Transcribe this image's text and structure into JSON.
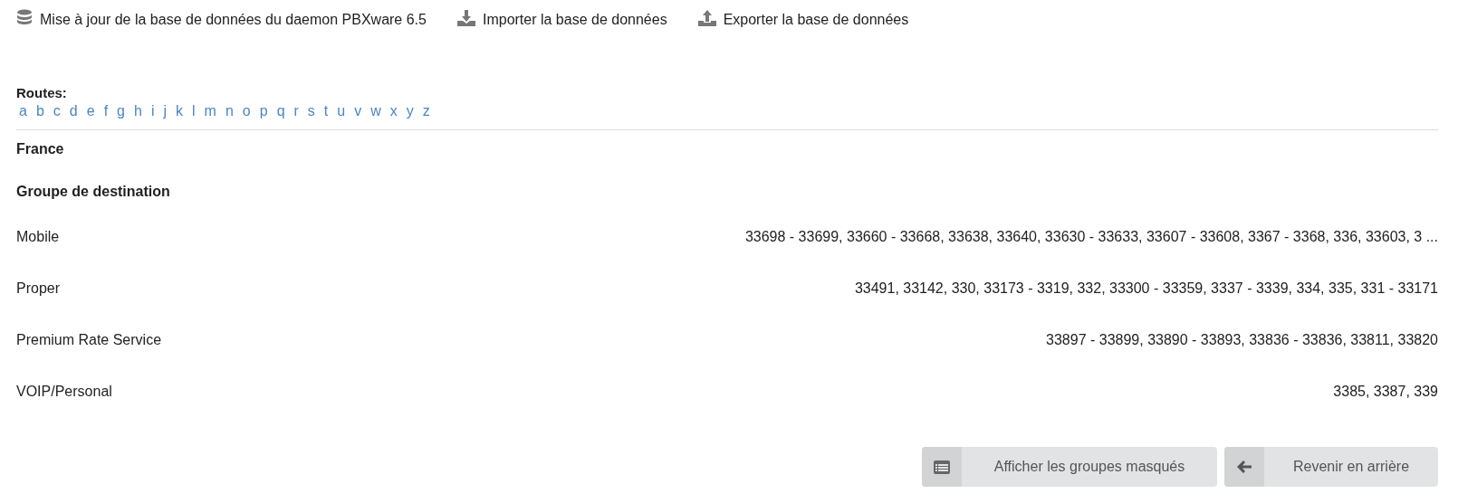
{
  "toolbar": [
    {
      "kind": "database",
      "label": "Mise à jour de la base de données du daemon PBXware 6.5"
    },
    {
      "kind": "download",
      "label": "Importer la base de données"
    },
    {
      "kind": "upload",
      "label": "Exporter la base de données"
    }
  ],
  "routes": {
    "label": "Routes:",
    "letters": [
      "a",
      "b",
      "c",
      "d",
      "e",
      "f",
      "g",
      "h",
      "i",
      "j",
      "k",
      "l",
      "m",
      "n",
      "o",
      "p",
      "q",
      "r",
      "s",
      "t",
      "u",
      "v",
      "w",
      "x",
      "y",
      "z"
    ]
  },
  "country": "France",
  "group_heading": "Groupe de destination",
  "groups": [
    {
      "name": "Mobile",
      "codes": "33698 - 33699, 33660 - 33668, 33638, 33640, 33630 - 33633, 33607 - 33608, 3367 - 3368, 336, 33603, 3 ..."
    },
    {
      "name": "Proper",
      "codes": "33491, 33142, 330, 33173 - 3319, 332, 33300 - 33359, 3337 - 3339, 334, 335, 331 - 33171"
    },
    {
      "name": "Premium Rate Service",
      "codes": "33897 - 33899, 33890 - 33893, 33836 - 33836, 33811, 33820"
    },
    {
      "name": "VOIP/Personal",
      "codes": "3385, 3387, 339"
    }
  ],
  "buttons": [
    {
      "kind": "list",
      "label": "Afficher les groupes masqués"
    },
    {
      "kind": "back",
      "label": "Revenir en arrière"
    }
  ]
}
